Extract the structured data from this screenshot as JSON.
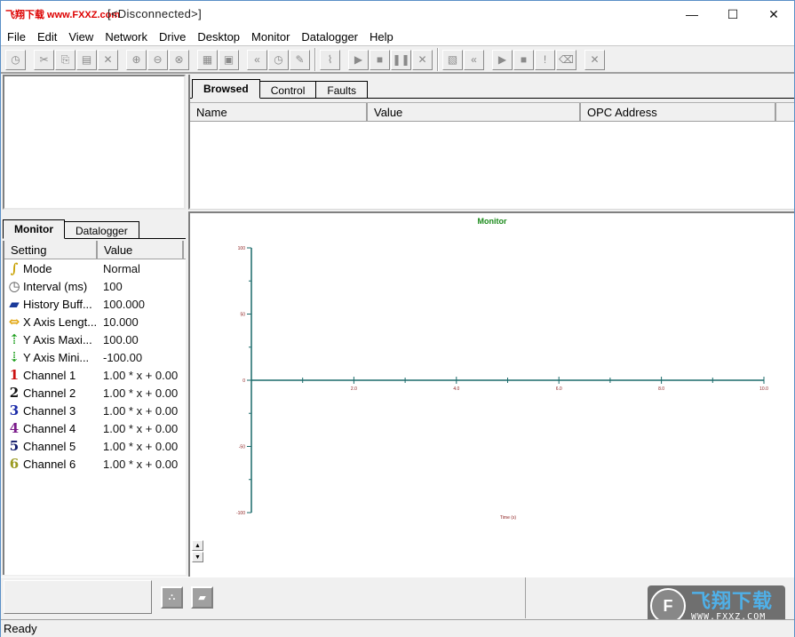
{
  "window": {
    "brand_overlay": "飞翔下载 www.FXXZ.com",
    "title": "[<Disconnected>]",
    "controls": {
      "minimize": "—",
      "maximize": "☐",
      "close": "✕"
    }
  },
  "menu": [
    "File",
    "Edit",
    "View",
    "Network",
    "Drive",
    "Desktop",
    "Monitor",
    "Datalogger",
    "Help"
  ],
  "toolbar": {
    "groups": [
      [
        {
          "name": "connect-icon",
          "glyph": "◷"
        }
      ],
      [
        {
          "name": "cut-icon",
          "glyph": "✂"
        },
        {
          "name": "copy-icon",
          "glyph": "⎘"
        },
        {
          "name": "paste-icon",
          "glyph": "▤"
        },
        {
          "name": "delete-icon",
          "glyph": "✕"
        }
      ],
      [
        {
          "name": "zoom-in-icon",
          "glyph": "⊕"
        },
        {
          "name": "zoom-out-icon",
          "glyph": "⊖"
        },
        {
          "name": "zoom-fit-icon",
          "glyph": "⊗"
        }
      ],
      [
        {
          "name": "properties-icon",
          "glyph": "▦"
        },
        {
          "name": "lock-icon",
          "glyph": "▣"
        }
      ],
      [
        {
          "name": "rewind-icon",
          "glyph": "«"
        },
        {
          "name": "clock-icon",
          "glyph": "◷"
        },
        {
          "name": "edit-icon",
          "glyph": "✎"
        }
      ]
    ],
    "monitor_group": [
      {
        "name": "chart-icon",
        "glyph": "⌇"
      }
    ],
    "monitor_controls": [
      {
        "name": "play-icon",
        "glyph": "▶"
      },
      {
        "name": "stop-icon",
        "glyph": "■"
      },
      {
        "name": "pause-icon",
        "glyph": "❚❚"
      },
      {
        "name": "cancel-icon",
        "glyph": "✕"
      }
    ],
    "datalogger_group": [
      {
        "name": "datalogger-window-icon",
        "glyph": "▧"
      },
      {
        "name": "datalogger-rewind-icon",
        "glyph": "«"
      }
    ],
    "datalogger_controls": [
      {
        "name": "datalogger-play-icon",
        "glyph": "▶"
      },
      {
        "name": "datalogger-stop-icon",
        "glyph": "■"
      },
      {
        "name": "trigger-icon",
        "glyph": "!"
      },
      {
        "name": "erase-icon",
        "glyph": "⌫"
      }
    ],
    "datalogger_close": {
      "name": "datalogger-close-icon",
      "glyph": "✕"
    }
  },
  "opc": {
    "tabs": [
      "Browsed",
      "Control",
      "Faults"
    ],
    "active_tab": "Browsed",
    "columns": [
      "Name",
      "Value",
      "OPC Address"
    ],
    "rows": []
  },
  "settings": {
    "tabs": [
      "Monitor",
      "Datalogger"
    ],
    "active_tab": "Monitor",
    "columns": [
      "Setting",
      "Value"
    ],
    "rows": [
      {
        "icon": "mode-icon",
        "glyph": "∫",
        "color": "#c8a000",
        "name": "Mode",
        "value": "Normal"
      },
      {
        "icon": "interval-clock-icon",
        "glyph": "◷",
        "color": "#555555",
        "name": "Interval (ms)",
        "value": "100"
      },
      {
        "icon": "history-book-icon",
        "glyph": "▰",
        "color": "#1a3a9a",
        "name": "History Buff...",
        "value": "100.000"
      },
      {
        "icon": "x-axis-length-icon",
        "glyph": "⇔",
        "color": "#e0a000",
        "name": "X Axis Lengt...",
        "value": "10.000"
      },
      {
        "icon": "y-axis-max-icon",
        "glyph": "⇡",
        "color": "#20a020",
        "name": "Y Axis Maxi...",
        "value": "100.00"
      },
      {
        "icon": "y-axis-min-icon",
        "glyph": "⇣",
        "color": "#20a020",
        "name": "Y Axis Mini...",
        "value": "-100.00"
      },
      {
        "icon": "channel-1-icon",
        "glyph": "1",
        "color": "#cc1111",
        "name": "Channel 1",
        "value": "1.00 * x + 0.00"
      },
      {
        "icon": "channel-2-icon",
        "glyph": "2",
        "color": "#111111",
        "name": "Channel 2",
        "value": "1.00 * x + 0.00"
      },
      {
        "icon": "channel-3-icon",
        "glyph": "3",
        "color": "#1a2aa8",
        "name": "Channel 3",
        "value": "1.00 * x + 0.00"
      },
      {
        "icon": "channel-4-icon",
        "glyph": "4",
        "color": "#7a1a8a",
        "name": "Channel 4",
        "value": "1.00 * x + 0.00"
      },
      {
        "icon": "channel-5-icon",
        "glyph": "5",
        "color": "#101a6a",
        "name": "Channel 5",
        "value": "1.00 * x + 0.00"
      },
      {
        "icon": "channel-6-icon",
        "glyph": "6",
        "color": "#9a9a20",
        "name": "Channel 6",
        "value": "1.00 * x + 0.00"
      }
    ]
  },
  "chart_data": {
    "type": "line",
    "title": "Monitor",
    "xlabel": "Time (s)",
    "ylabel": "",
    "xlim": [
      0,
      10
    ],
    "ylim": [
      -100,
      100
    ],
    "x_major_ticks": [
      2.0,
      4.0,
      6.0,
      8.0,
      10.0
    ],
    "x_tick_labels": [
      "2.0",
      "4.0",
      "6.0",
      "8.0",
      "10.0"
    ],
    "x_minor_ticks": [
      1,
      3,
      5,
      7,
      9
    ],
    "y_major_ticks": [
      100,
      50,
      0,
      -50,
      -100
    ],
    "y_tick_labels": [
      "100",
      "50",
      "0",
      "-50",
      "-100"
    ],
    "y_minor_ticks": [
      75,
      25,
      -25,
      -75
    ],
    "series": [],
    "grid": false,
    "colors": {
      "axis": "#1a6a6a",
      "title": "#1a8a1a",
      "tick_label": "#8a1a1a"
    }
  },
  "chart_scroll": {
    "up": "▲",
    "down": "▼"
  },
  "bottom": {
    "buttons": [
      {
        "name": "bottom-tool-1-icon",
        "glyph": "⛬"
      },
      {
        "name": "bottom-eraser-icon",
        "glyph": "▰"
      }
    ]
  },
  "watermark": {
    "cn": "飞翔下载",
    "url": "WWW.FXXZ.COM",
    "logo": "F"
  },
  "status": "Ready"
}
